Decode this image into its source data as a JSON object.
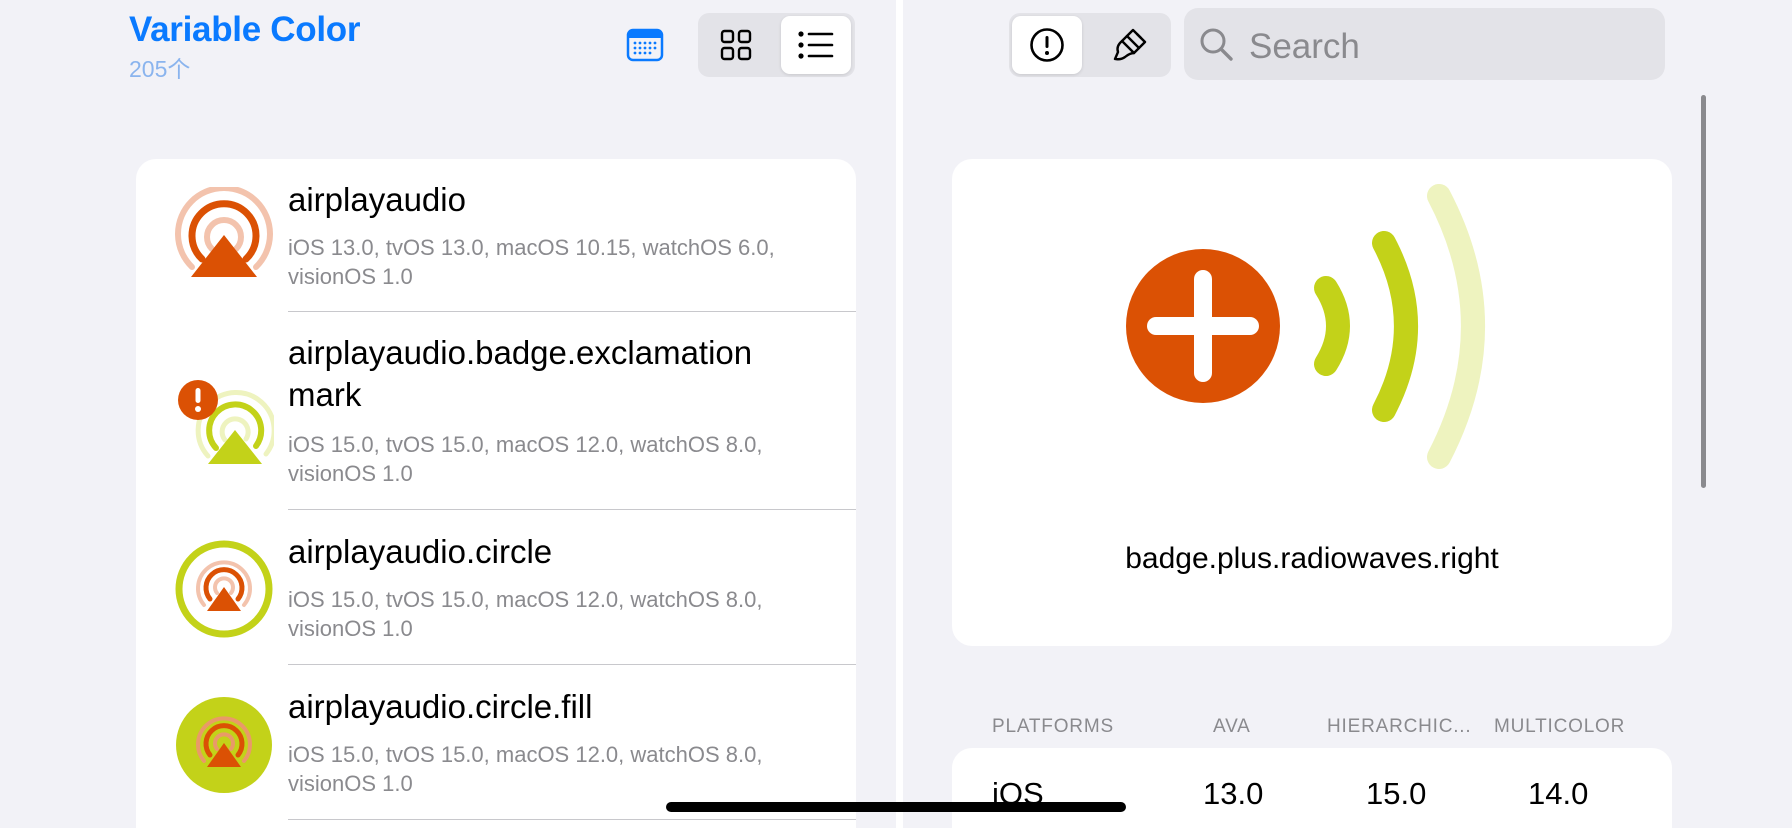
{
  "app": {
    "title": "Variable Color",
    "count": "205个"
  },
  "toolbar": {
    "calendar_icon": "calendar-icon",
    "view_modes": [
      {
        "icon": "grid-icon",
        "selected": false
      },
      {
        "icon": "list-icon",
        "selected": true
      }
    ]
  },
  "symbols": [
    {
      "name": "airplayaudio",
      "platforms": "iOS 13.0, tvOS 13.0, macOS 10.15, watchOS 6.0, visionOS 1.0",
      "icon": "airplayaudio-icon"
    },
    {
      "name": "airplayaudio.badge.exclamation mark",
      "platforms": "iOS 15.0, tvOS 15.0, macOS 12.0, watchOS 8.0, visionOS 1.0",
      "icon": "airplayaudio-badge-exclamationmark-icon"
    },
    {
      "name": "airplayaudio.circle",
      "platforms": "iOS 15.0, tvOS 15.0, macOS 12.0, watchOS 8.0, visionOS 1.0",
      "icon": "airplayaudio-circle-icon"
    },
    {
      "name": "airplayaudio.circle.fill",
      "platforms": "iOS 15.0, tvOS 15.0, macOS 12.0, watchOS 8.0, visionOS 1.0",
      "icon": "airplayaudio-circle-fill-icon"
    }
  ],
  "detail": {
    "mode_buttons": [
      {
        "icon": "exclamationmark-circle-icon",
        "selected": true
      },
      {
        "icon": "paintbrush-icon",
        "selected": false
      }
    ],
    "search": {
      "placeholder": "Search",
      "icon": "magnifyingglass-icon"
    },
    "symbol_name": "badge.plus.radiowaves.right",
    "table": {
      "headers": [
        "PLATFORMS",
        "AVA",
        "HIERARCHIC...",
        "MULTICOLOR"
      ],
      "rows": [
        {
          "platform": "iOS",
          "ava": "13.0",
          "hierarchical": "15.0",
          "multicolor": "14.0"
        }
      ]
    }
  },
  "colors": {
    "accent": "#0a7aff",
    "orange": "#db5104",
    "lime": "#c3d219",
    "lime_light": "#eef3bf"
  }
}
